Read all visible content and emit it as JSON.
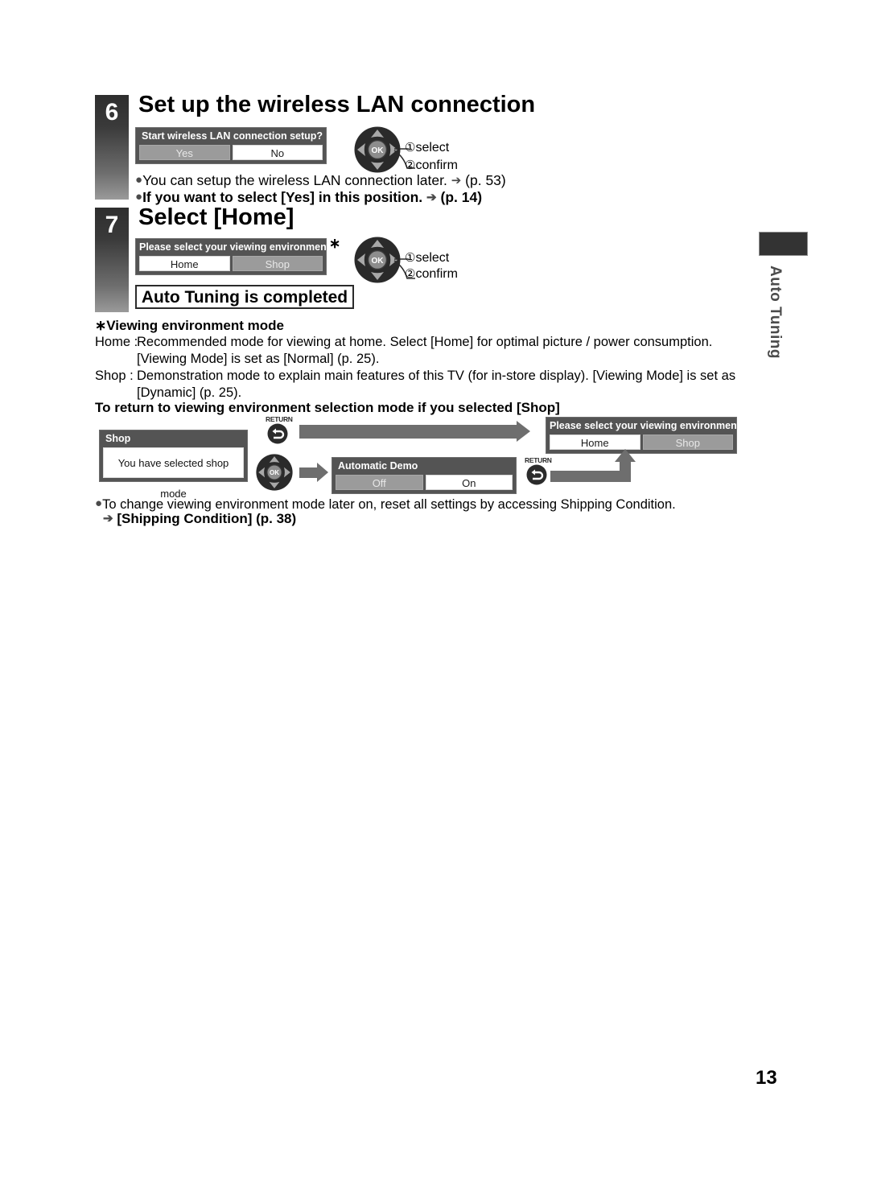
{
  "page": {
    "number": "13",
    "side_tab_label": "Auto Tuning"
  },
  "steps": [
    {
      "number": "6",
      "title": "Set up the wireless LAN connection",
      "dialog": {
        "title": "Start wireless LAN connection setup?",
        "buttons": [
          {
            "label": "Yes",
            "state": "unselected"
          },
          {
            "label": "No",
            "state": "selected"
          }
        ]
      },
      "remote": {
        "ok_label": "OK",
        "actions": [
          {
            "num": "①",
            "label": "select"
          },
          {
            "num": "②",
            "label": "confirm"
          }
        ]
      },
      "notes": [
        {
          "text": "You can setup the wireless LAN connection later.",
          "arrow": "➔",
          "ref": "(p. 53)",
          "bold": false
        },
        {
          "text": "If you want to select [Yes] in this position.",
          "arrow": "➔",
          "ref": "(p. 14)",
          "bold": true
        }
      ]
    },
    {
      "number": "7",
      "title": "Select [Home]",
      "dialog": {
        "title": "Please select your viewing environment.",
        "buttons": [
          {
            "label": "Home",
            "state": "selected"
          },
          {
            "label": "Shop",
            "state": "unselected"
          }
        ]
      },
      "footnote_marker": "∗",
      "remote": {
        "ok_label": "OK",
        "actions": [
          {
            "num": "①",
            "label": "select"
          },
          {
            "num": "②",
            "label": "confirm"
          }
        ]
      },
      "completed_box": "Auto Tuning is completed"
    }
  ],
  "viewing_mode": {
    "heading": "∗Viewing environment mode",
    "rows": [
      {
        "label": "Home :",
        "text": "Recommended mode for viewing at home. Select [Home] for optimal picture / power consumption. [Viewing Mode] is set as [Normal] (p. 25)."
      },
      {
        "label": "Shop  :",
        "text": "Demonstration mode to explain main features of this TV (for in-store display). [Viewing Mode] is set as [Dynamic] (p. 25)."
      }
    ]
  },
  "return_section": {
    "heading": "To return to viewing environment selection mode if you selected [Shop]",
    "shop_dialog": {
      "title": "Shop",
      "body": "You have selected shop mode"
    },
    "return_caption": "RETURN",
    "remote_ok_label": "OK",
    "demo_dialog": {
      "title": "Automatic Demo",
      "buttons": [
        {
          "label": "Off",
          "state": "unselected"
        },
        {
          "label": "On",
          "state": "selected"
        }
      ]
    },
    "env_dialog": {
      "title": "Please select your viewing environment.",
      "buttons": [
        {
          "label": "Home",
          "state": "selected"
        },
        {
          "label": "Shop",
          "state": "unselected"
        }
      ]
    }
  },
  "footer_notes": [
    {
      "text": "To change viewing environment mode later on, reset all settings by accessing Shipping Condition.",
      "bold": false
    },
    {
      "arrow": "➔",
      "text": "[Shipping Condition] (p. 38)",
      "bold": true
    }
  ]
}
